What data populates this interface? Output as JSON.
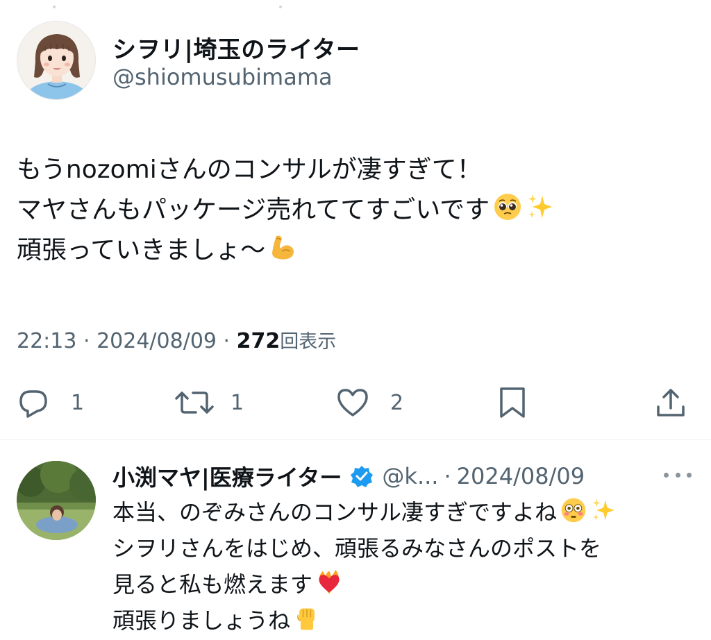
{
  "tweet": {
    "author_name": "シヲリ|埼玉のライター",
    "author_handle": "@shiomusubimama",
    "lines": [
      "もうnozomiさんのコンサルが凄すぎて！",
      "マヤさんもパッケージ売れててすごいです",
      "頑張っていきましょ〜"
    ],
    "time": "22:13",
    "date": "2024/08/09",
    "separator": " · ",
    "views_count": "272",
    "views_label": "回表示",
    "reply_count": "1",
    "retweet_count": "1",
    "like_count": "2"
  },
  "reply": {
    "author_name": "小渕マヤ|医療ライター",
    "author_handle": "@k...",
    "separator": "·",
    "date": "2024/08/09",
    "lines": [
      "本当、のぞみさんのコンサル凄すぎですよね",
      "シヲリさんをはじめ、頑張るみなさんのポストを",
      "見ると私も燃えます",
      "頑張りましょうね"
    ]
  },
  "colors": {
    "text": "#0f1419",
    "secondary": "#536471",
    "verified": "#1d9bf0",
    "divider": "#eff3f4"
  },
  "icons": [
    "reply-icon",
    "retweet-icon",
    "like-icon",
    "bookmark-icon",
    "share-icon",
    "verified-badge-icon",
    "more-icon",
    "pleading-face-emoji",
    "sparkles-emoji",
    "flexed-biceps-emoji",
    "flushed-face-emoji",
    "heart-on-fire-emoji",
    "raised-fist-emoji"
  ]
}
